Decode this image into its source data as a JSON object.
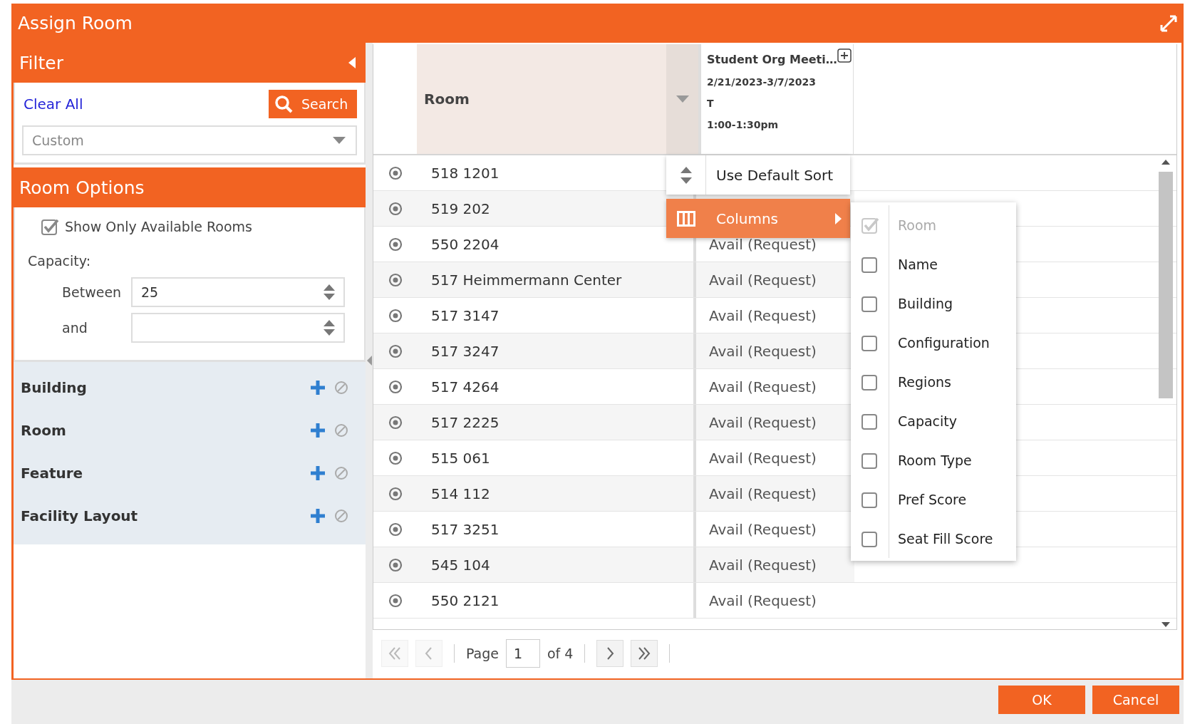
{
  "window": {
    "title": "Assign Room"
  },
  "filter": {
    "title": "Filter",
    "clear_all": "Clear All",
    "search_button": "Search",
    "preset": {
      "value": "Custom"
    }
  },
  "room_options": {
    "title": "Room Options",
    "available_only": {
      "label": "Show Only Available Rooms",
      "checked": true
    },
    "capacity_label": "Capacity:",
    "min": {
      "label": "Between",
      "value": "25"
    },
    "max": {
      "label": "and"
    }
  },
  "filter_groups": [
    {
      "label": "Building"
    },
    {
      "label": "Room"
    },
    {
      "label": "Feature"
    },
    {
      "label": "Facility Layout"
    }
  ],
  "grid": {
    "room_column": "Room",
    "event": {
      "title": "Student Org Meeti…",
      "dates": "2/21/2023-3/7/2023",
      "days": "T",
      "time": "1:00-1:30pm"
    },
    "rows": [
      {
        "room": "518 1201"
      },
      {
        "room": "519 202"
      },
      {
        "room": "550 2204",
        "availability": "Avail (Request)"
      },
      {
        "room": "517 Heimmermann Center",
        "availability": "Avail (Request)"
      },
      {
        "room": "517 3147",
        "availability": "Avail (Request)"
      },
      {
        "room": "517 3247",
        "availability": "Avail (Request)"
      },
      {
        "room": "517 4264",
        "availability": "Avail (Request)"
      },
      {
        "room": "517 2225",
        "availability": "Avail (Request)"
      },
      {
        "room": "515 061",
        "availability": "Avail (Request)"
      },
      {
        "room": "514 112",
        "availability": "Avail (Request)"
      },
      {
        "room": "517 3251",
        "availability": "Avail (Request)"
      },
      {
        "room": "545 104",
        "availability": "Avail (Request)"
      },
      {
        "room": "550 2121",
        "availability": "Avail (Request)"
      }
    ]
  },
  "context_menu": [
    {
      "label": "Use Default Sort",
      "kind": "sort",
      "selected": false
    },
    {
      "label": "Columns",
      "kind": "submenu",
      "selected": true
    }
  ],
  "columns_menu": [
    {
      "label": "Room",
      "checked": true,
      "disabled": true
    },
    {
      "label": "Name",
      "checked": false,
      "disabled": false
    },
    {
      "label": "Building",
      "checked": false,
      "disabled": false
    },
    {
      "label": "Configuration",
      "checked": false,
      "disabled": false
    },
    {
      "label": "Regions",
      "checked": false,
      "disabled": false
    },
    {
      "label": "Capacity",
      "checked": false,
      "disabled": false
    },
    {
      "label": "Room Type",
      "checked": false,
      "disabled": false
    },
    {
      "label": "Pref Score",
      "checked": false,
      "disabled": false
    },
    {
      "label": "Seat Fill Score",
      "checked": false,
      "disabled": false
    }
  ],
  "pager": {
    "page_label": "Page",
    "page": "1",
    "of": "of 4",
    "nav": [
      {
        "kind": "first",
        "disabled": true
      },
      {
        "kind": "prev",
        "disabled": true
      },
      {
        "kind": "next",
        "disabled": false
      },
      {
        "kind": "last",
        "disabled": false
      }
    ]
  },
  "buttons": [
    {
      "label": "OK"
    },
    {
      "label": "Cancel"
    }
  ]
}
